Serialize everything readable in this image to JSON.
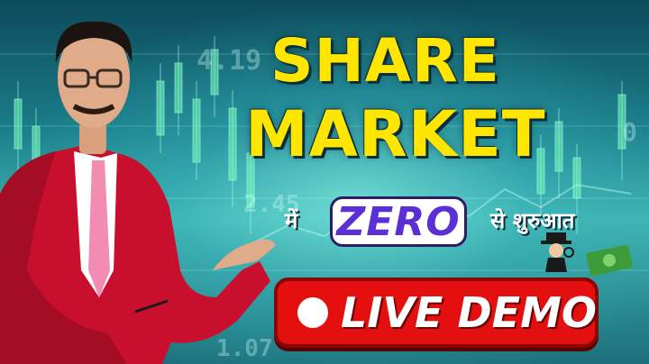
{
  "headline": {
    "line1": "SHARE",
    "line2": "MARKET"
  },
  "subline": {
    "prefix": "में",
    "highlight": "ZERO",
    "suffix": "से शुरुआत"
  },
  "badge": {
    "label": "LIVE DEMO"
  },
  "background": {
    "tickers": [
      "4.19",
      "2.45",
      "1.07",
      "0"
    ]
  },
  "colors": {
    "headline": "#ffe600",
    "zero": "#5a2fd6",
    "live_button": "#e3100f",
    "jacket": "#c8102e",
    "background": "#1a7d88"
  },
  "icons": [
    "record-dot-icon",
    "money-icon",
    "mascot-icon",
    "candlestick-chart"
  ]
}
